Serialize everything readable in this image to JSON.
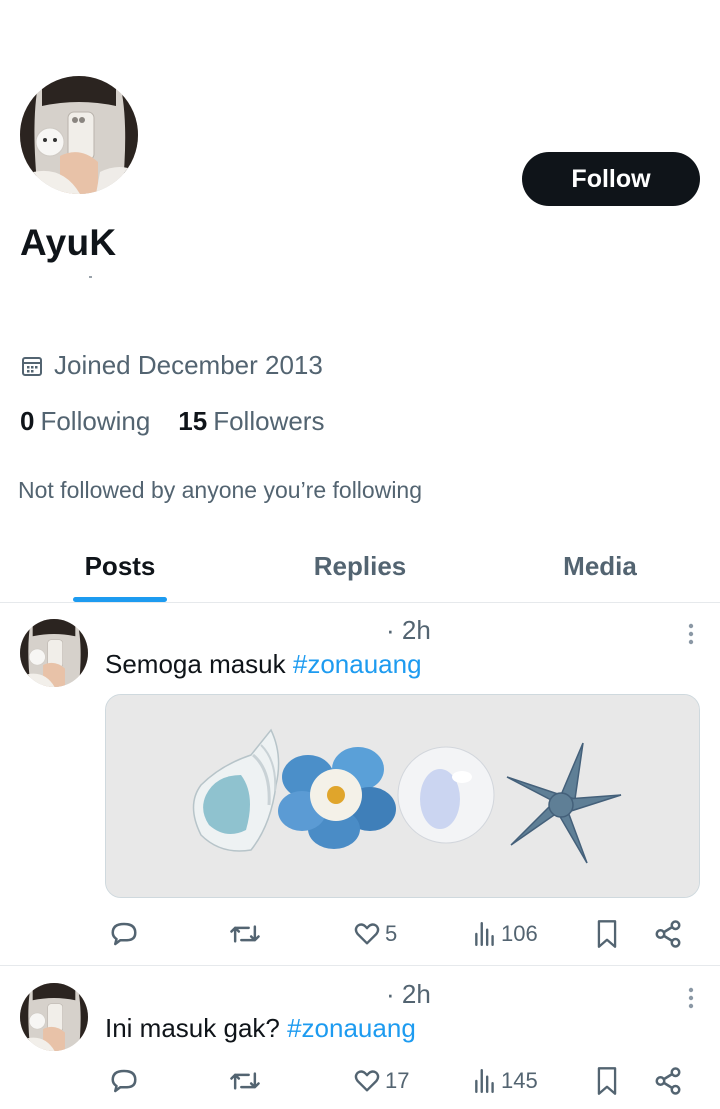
{
  "profile": {
    "display_name": "AyuK",
    "follow_label": "Follow",
    "joined_text": "Joined December 2013",
    "following_count": "0",
    "following_label": "Following",
    "followers_count": "15",
    "followers_label": "Followers",
    "not_followed_text": "Not followed by anyone you’re following"
  },
  "tabs": [
    {
      "label": "Posts",
      "active": true
    },
    {
      "label": "Replies",
      "active": false
    },
    {
      "label": "Media",
      "active": false
    }
  ],
  "posts": [
    {
      "time": "· 2h",
      "text": "Semoga masuk ",
      "hashtag": "#zonauang",
      "likes": "5",
      "views": "106"
    },
    {
      "time": "· 2h",
      "text": "Ini masuk gak? ",
      "hashtag": "#zonauang",
      "likes": "17",
      "views": "145"
    }
  ],
  "colors": {
    "accent": "#1d9bf0",
    "text_primary": "#0f1419",
    "text_secondary": "#536471",
    "button_bg": "#0f1419"
  }
}
